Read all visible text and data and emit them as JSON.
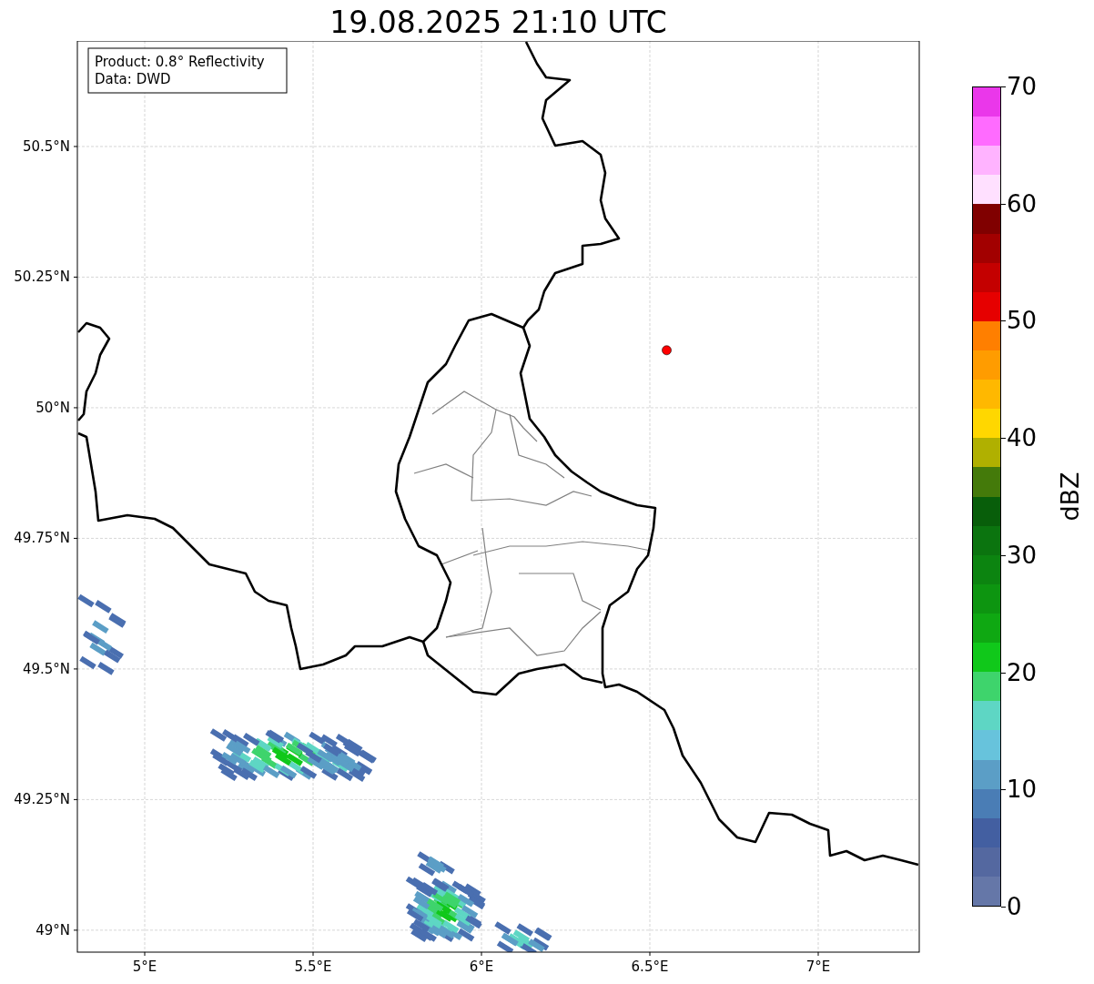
{
  "chart_data": {
    "type": "scatter",
    "title": "19.08.2025 21:10 UTC",
    "grid": true,
    "xlim": [
      4.8,
      7.3
    ],
    "ylim": [
      48.958,
      50.702
    ],
    "xticks": [
      {
        "value": 5,
        "label": "5°E"
      },
      {
        "value": 5.5,
        "label": "5.5°E"
      },
      {
        "value": 6,
        "label": "6°E"
      },
      {
        "value": 6.5,
        "label": "6.5°E"
      },
      {
        "value": 7,
        "label": "7°E"
      }
    ],
    "yticks": [
      {
        "value": 49,
        "label": "49°N"
      },
      {
        "value": 49.25,
        "label": "49.25°N"
      },
      {
        "value": 49.5,
        "label": "49.5°N"
      },
      {
        "value": 49.75,
        "label": "49.75°N"
      },
      {
        "value": 50,
        "label": "50°N"
      },
      {
        "value": 50.25,
        "label": "50.25°N"
      },
      {
        "value": 50.5,
        "label": "50.5°N"
      }
    ],
    "x": [
      6.55
    ],
    "series": [
      {
        "color": "#ff0000",
        "values": [
          50.11
        ]
      }
    ]
  },
  "info_box": [
    "Product: 0.8° Reflectivity",
    "Data: DWD"
  ],
  "colorbar": {
    "label": "dBZ",
    "ticks": [
      "70",
      "60",
      "50",
      "40",
      "30",
      "20",
      "10",
      "0"
    ],
    "bands": [
      {
        "color": "#ea37ea"
      },
      {
        "color": "#ff6bff"
      },
      {
        "color": "#ffb3ff"
      },
      {
        "color": "#ffe0ff"
      },
      {
        "color": "#800000"
      },
      {
        "color": "#a20000"
      },
      {
        "color": "#c40000"
      },
      {
        "color": "#e60000"
      },
      {
        "color": "#ff7f00"
      },
      {
        "color": "#ff9c00"
      },
      {
        "color": "#ffb800"
      },
      {
        "color": "#ffd700"
      },
      {
        "color": "#b0b000"
      },
      {
        "color": "#447a0a"
      },
      {
        "color": "#085e0a"
      },
      {
        "color": "#0b740f"
      },
      {
        "color": "#0c8410"
      },
      {
        "color": "#0d9510"
      },
      {
        "color": "#0fa812"
      },
      {
        "color": "#10c81a"
      },
      {
        "color": "#3ed46c"
      },
      {
        "color": "#5ed6c4"
      },
      {
        "color": "#67c3dc"
      },
      {
        "color": "#5b9ec6"
      },
      {
        "color": "#4a7db5"
      },
      {
        "color": "#435fa1"
      },
      {
        "color": "#5468a0"
      },
      {
        "color": "#6577a8"
      }
    ]
  }
}
